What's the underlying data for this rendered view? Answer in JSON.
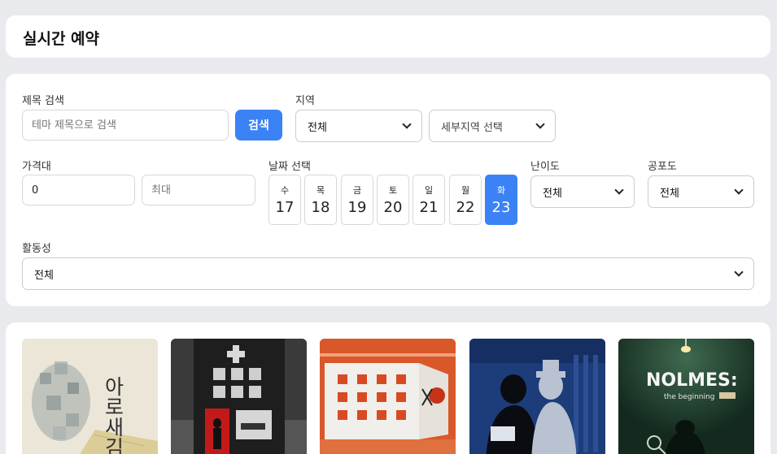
{
  "header": {
    "title": "실시간 예약"
  },
  "search": {
    "label": "제목 검색",
    "placeholder": "테마 제목으로 검색",
    "button": "검색"
  },
  "region": {
    "label": "지역",
    "value": "전체",
    "sub_value": "세부지역 선택"
  },
  "price": {
    "label": "가격대",
    "min_value": "0",
    "max_placeholder": "최대"
  },
  "date": {
    "label": "날짜 선택",
    "days": [
      {
        "dow": "수",
        "num": "17"
      },
      {
        "dow": "목",
        "num": "18"
      },
      {
        "dow": "금",
        "num": "19"
      },
      {
        "dow": "토",
        "num": "20"
      },
      {
        "dow": "일",
        "num": "21"
      },
      {
        "dow": "월",
        "num": "22"
      },
      {
        "dow": "화",
        "num": "23"
      }
    ],
    "selected_index": 6
  },
  "difficulty": {
    "label": "난이도",
    "value": "전체"
  },
  "fear": {
    "label": "공포도",
    "value": "전체"
  },
  "activity": {
    "label": "활동성",
    "value": "전체"
  },
  "themes": [
    {
      "poster_text": "아로새김"
    },
    {
      "poster_text": ""
    },
    {
      "poster_text": ""
    },
    {
      "poster_text": ""
    },
    {
      "poster_text": "NOLMES:",
      "poster_sub": "the beginning"
    }
  ],
  "colors": {
    "accent": "#3b82f6",
    "background": "#e9eaee"
  }
}
